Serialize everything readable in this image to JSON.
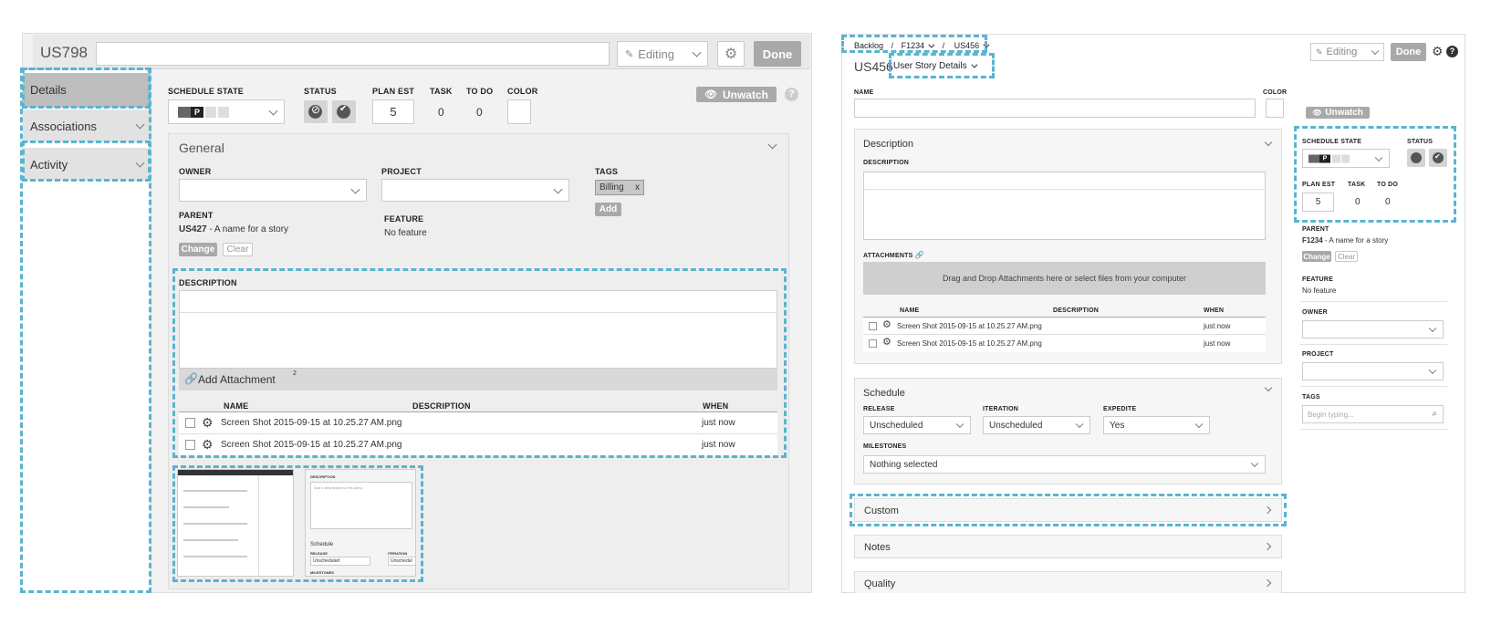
{
  "left": {
    "id": "US798",
    "editing_label": "Editing",
    "done_label": "Done",
    "nav": [
      "Details",
      "Associations",
      "Activity"
    ],
    "fields": {
      "schedule_state_label": "SCHEDULE STATE",
      "schedule_state_value": "P",
      "status_label": "STATUS",
      "plan_est_label": "PLAN EST",
      "plan_est_value": "5",
      "task_label": "TASK",
      "task_value": "0",
      "todo_label": "TO DO",
      "todo_value": "0",
      "color_label": "COLOR"
    },
    "unwatch_label": "Unwatch",
    "help_glyph": "?",
    "general_title": "General",
    "owner_label": "OWNER",
    "project_label": "PROJECT",
    "tags_label": "TAGS",
    "tag": "Billing",
    "tag_remove": "x",
    "add_label": "Add",
    "parent_label": "PARENT",
    "parent_id": "US427",
    "parent_name": " - A name for a story",
    "feature_label": "FEATURE",
    "feature_value": "No feature",
    "change_label": "Change",
    "clear_label": "Clear",
    "description_label": "DESCRIPTION",
    "add_attachment_label": "Add Attachment",
    "attachment_count": "2",
    "table_headers": [
      "NAME",
      "DESCRIPTION",
      "WHEN"
    ],
    "attachments": [
      {
        "name": "Screen Shot 2015-09-15 at 10.25.27 AM.png",
        "when": "just now"
      },
      {
        "name": "Screen Shot 2015-09-15 at 10.25.27 AM.png",
        "when": "just now"
      }
    ],
    "thumb": {
      "description_label": "DESCRIPTION",
      "placeholder": "Add a description to this story...",
      "schedule_label": "Schedule",
      "release_label": "RELEASE",
      "iteration_label": "ITERATION",
      "release_value": "Unscheduled",
      "iteration_value": "Unschedul",
      "milestones_label": "MILESTONES"
    }
  },
  "right": {
    "breadcrumb": [
      "Backlog",
      "F1234",
      "US456"
    ],
    "breadcrumb_sep": "/",
    "id": "US456",
    "view_select": "User Story Details",
    "editing_label": "Editing",
    "done_label": "Done",
    "help_glyph": "?",
    "name_label": "NAME",
    "color_label": "COLOR",
    "unwatch_label": "Unwatch",
    "description_section": "Description",
    "description_label": "DESCRIPTION",
    "attachments_label": "ATTACHMENTS",
    "drop_text": "Drag and Drop Attachments here or select files from your computer",
    "table_headers": [
      "NAME",
      "DESCRIPTION",
      "WHEN"
    ],
    "attachments": [
      {
        "name": "Screen Shot 2015-09-15 at 10.25.27 AM.png",
        "when": "just now"
      },
      {
        "name": "Screen Shot 2015-09-15 at 10.25.27 AM.png",
        "when": "just now"
      }
    ],
    "schedule_section": "Schedule",
    "release_label": "RELEASE",
    "release_value": "Unscheduled",
    "iteration_label": "ITERATION",
    "iteration_value": "Unscheduled",
    "expedite_label": "EXPEDITE",
    "expedite_value": "Yes",
    "milestones_label": "MILESTONES",
    "milestones_value": "Nothing selected",
    "custom_section": "Custom",
    "notes_section": "Notes",
    "quality_section": "Quality",
    "side": {
      "schedule_state_label": "SCHEDULE STATE",
      "schedule_state_value": "P",
      "status_label": "STATUS",
      "plan_est_label": "PLAN EST",
      "plan_est_value": "5",
      "task_label": "TASK",
      "task_value": "0",
      "todo_label": "TO DO",
      "todo_value": "0",
      "parent_label": "PARENT",
      "parent_id": "F1234",
      "parent_name": " - A name for a story",
      "change_label": "Change",
      "clear_label": "Clear",
      "feature_label": "FEATURE",
      "feature_value": "No feature",
      "owner_label": "OWNER",
      "project_label": "PROJECT",
      "tags_label": "TAGS",
      "tags_placeholder": "Begin typing..."
    }
  },
  "colors": {
    "accent_dash": "#5ab4d0",
    "button_gray": "#a9a9a9",
    "header_bg": "#e9e9e9",
    "nav_selected": "#bdbdbd"
  }
}
